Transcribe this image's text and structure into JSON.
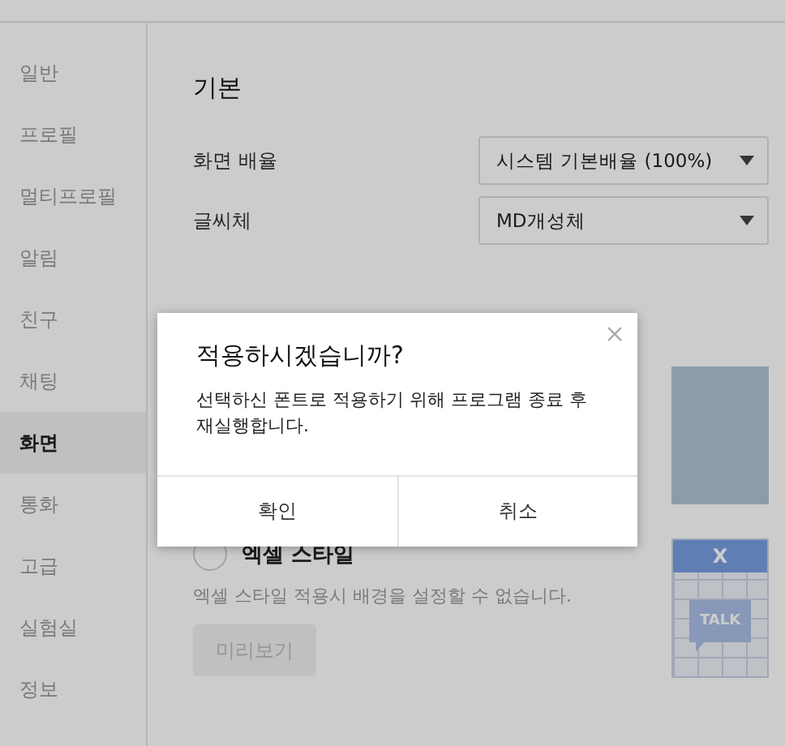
{
  "sidebar": {
    "items": [
      {
        "label": "일반",
        "selected": false
      },
      {
        "label": "프로필",
        "selected": false
      },
      {
        "label": "멀티프로필",
        "selected": false
      },
      {
        "label": "알림",
        "selected": false
      },
      {
        "label": "친구",
        "selected": false
      },
      {
        "label": "채팅",
        "selected": false
      },
      {
        "label": "화면",
        "selected": true
      },
      {
        "label": "통화",
        "selected": false
      },
      {
        "label": "고급",
        "selected": false
      },
      {
        "label": "실험실",
        "selected": false
      },
      {
        "label": "정보",
        "selected": false
      }
    ]
  },
  "basic": {
    "title": "기본",
    "settings": [
      {
        "label": "화면 배율",
        "value": "시스템 기본배율 (100%)"
      },
      {
        "label": "글씨체",
        "value": "MD개성체"
      }
    ]
  },
  "chat_style": {
    "option": {
      "label": "엑셀 스타일",
      "selected": false
    },
    "note": "엑셀 스타일 적용시 배경을 설정할 수 없습니다.",
    "preview_button": {
      "label": "미리보기",
      "disabled": true
    },
    "thumbnail": {
      "header": "X",
      "bubble": "TALK"
    }
  },
  "dialog": {
    "title": "적용하시겠습니까?",
    "message": "선택하신 폰트로 적용하기 위해 프로그램 종료 후 재실행합니다.",
    "buttons": [
      "확인",
      "취소"
    ]
  }
}
